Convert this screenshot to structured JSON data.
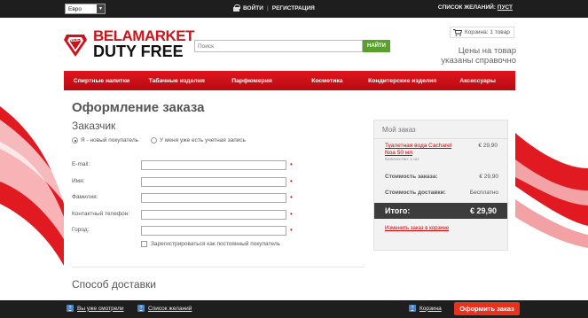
{
  "colors": {
    "brand_red": "#d0121b",
    "nav_red": "#e0141c",
    "topbar": "#1e1e1e",
    "search_green": "#5aa02c",
    "checkout_orange": "#e6331e",
    "total_bg": "#3c3c3c"
  },
  "topbar": {
    "currency": "Евро",
    "login": "ВОЙТИ",
    "register": "РЕГИСТРАЦИЯ",
    "wishlist_label": "СПИСОК ЖЕЛАНИЙ:",
    "wishlist_value": "ПУСТ"
  },
  "header": {
    "logo_badge": "BDF",
    "logo_line1": "BELAMARKET",
    "logo_line2": "DUTY FREE",
    "search_placeholder": "Поиск",
    "search_button": "НАЙТИ",
    "cart_mini": "Корзина: 1 товар",
    "price_note": "Цены на товар указаны справочно"
  },
  "nav": {
    "items": [
      "Спиртные напитки",
      "Табачные изделия",
      "Парфюмерия",
      "Косметика",
      "Кондитерские изделия",
      "Аксессуары"
    ]
  },
  "checkout": {
    "page_title": "Оформление заказа",
    "customer_title": "Заказчик",
    "radio_new": "Я - новый покупатель",
    "radio_existing": "У меня уже есть учетная запись",
    "fields": [
      {
        "label": "E-mail:"
      },
      {
        "label": "Имя:"
      },
      {
        "label": "Фамилия:"
      },
      {
        "label": "Контактный телефон:"
      },
      {
        "label": "Город:"
      }
    ],
    "register_label": "Зарегистрироваться как постоянный покупатель",
    "delivery_title": "Способ доставки"
  },
  "order": {
    "title": "Мой заказ",
    "item_name": "Туалетная вода Cacharel Noa 50 мл",
    "item_qty": "Количество: 1 шт.",
    "item_price": "€ 29,90",
    "cost_label": "Стоимость заказа:",
    "cost_value": "€ 29,90",
    "delivery_label": "Стоимость доставки:",
    "delivery_value": "Бесплатно",
    "total_label": "Итого:",
    "total_value": "€ 29,90",
    "change_link": "Изменить заказ в корзине"
  },
  "bottombar": {
    "viewed": "Вы уже смотрели",
    "wishlist": "Список желаний",
    "cart": "Корзина",
    "checkout_button": "Оформить заказ"
  }
}
